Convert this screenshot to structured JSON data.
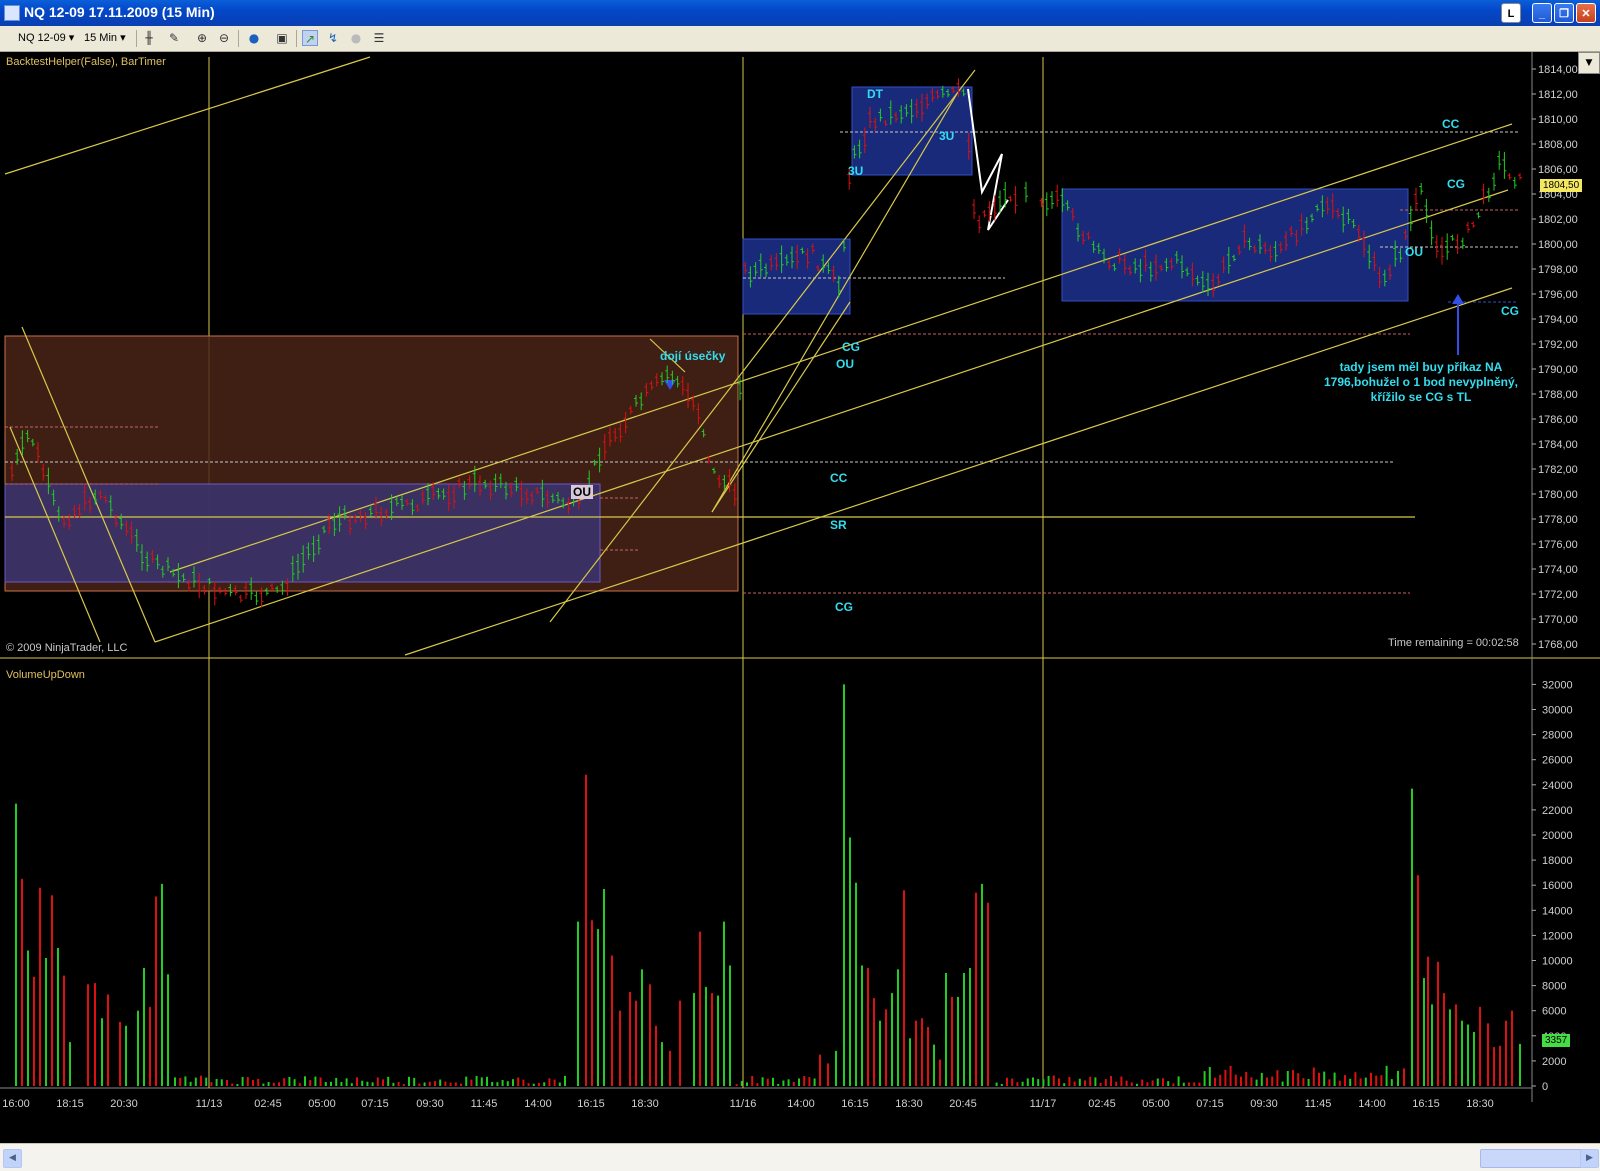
{
  "window": {
    "title": "NQ 12-09  17.11.2009 (15 Min)",
    "buttons": [
      "L",
      "_",
      "❐",
      "✕"
    ]
  },
  "toolbar": {
    "instrument": "NQ 12-09",
    "interval": "15 Min",
    "icons": [
      "bar-chart-type-icon",
      "drawing-tool-icon",
      "zoom-in-icon",
      "zoom-out-icon",
      "globe-icon",
      "properties-icon",
      "strategy-icon",
      "indicator-icon",
      "disabled-circle-icon",
      "data-box-icon"
    ]
  },
  "price_panel": {
    "indicator_label": "BacktestHelper(False), BarTimer",
    "copyright": "© 2009 NinjaTrader, LLC",
    "time_remaining": "Time remaining = 00:02:58",
    "y_ticks": [
      "1814,00",
      "1812,00",
      "1810,00",
      "1808,00",
      "1806,00",
      "1804,00",
      "1802,00",
      "1800,00",
      "1798,00",
      "1796,00",
      "1794,00",
      "1792,00",
      "1790,00",
      "1788,00",
      "1786,00",
      "1784,00",
      "1782,00",
      "1780,00",
      "1778,00",
      "1776,00",
      "1774,00",
      "1772,00",
      "1770,00",
      "1768,00"
    ],
    "last_price": "1804,50",
    "annotations": [
      "DT",
      "3U",
      "3U",
      "dojí úsečky",
      "OU",
      "CG",
      "OU",
      "CC",
      "SR",
      "CG",
      "CC",
      "CG",
      "OU",
      "CG"
    ],
    "note_lines": [
      "tady jsem měl buy příkaz NA",
      "1796,bohužel o 1 bod nevyplněný,",
      "křížilo se CG s TL"
    ]
  },
  "volume_panel": {
    "indicator_label": "VolumeUpDown",
    "y_ticks": [
      "32000",
      "30000",
      "28000",
      "26000",
      "24000",
      "22000",
      "20000",
      "18000",
      "16000",
      "14000",
      "12000",
      "10000",
      "8000",
      "6000",
      "4000",
      "2000",
      "0"
    ],
    "last_volume": "3357"
  },
  "x_axis": {
    "labels": [
      "16:00",
      "18:15",
      "20:30",
      "11/13",
      "02:45",
      "05:00",
      "07:15",
      "09:30",
      "11:45",
      "14:00",
      "16:15",
      "18:30",
      "11/16",
      "14:00",
      "16:15",
      "18:30",
      "20:45",
      "11/17",
      "02:45",
      "05:00",
      "07:15",
      "09:30",
      "11:45",
      "14:00",
      "16:15",
      "18:30"
    ]
  },
  "colors": {
    "up": "#22cc22",
    "down": "#dd1111",
    "trendline": "#d8c84a",
    "box_blue": "#1a2a7a",
    "box_brown": "#4a2418",
    "annotation": "#33ddee"
  }
}
